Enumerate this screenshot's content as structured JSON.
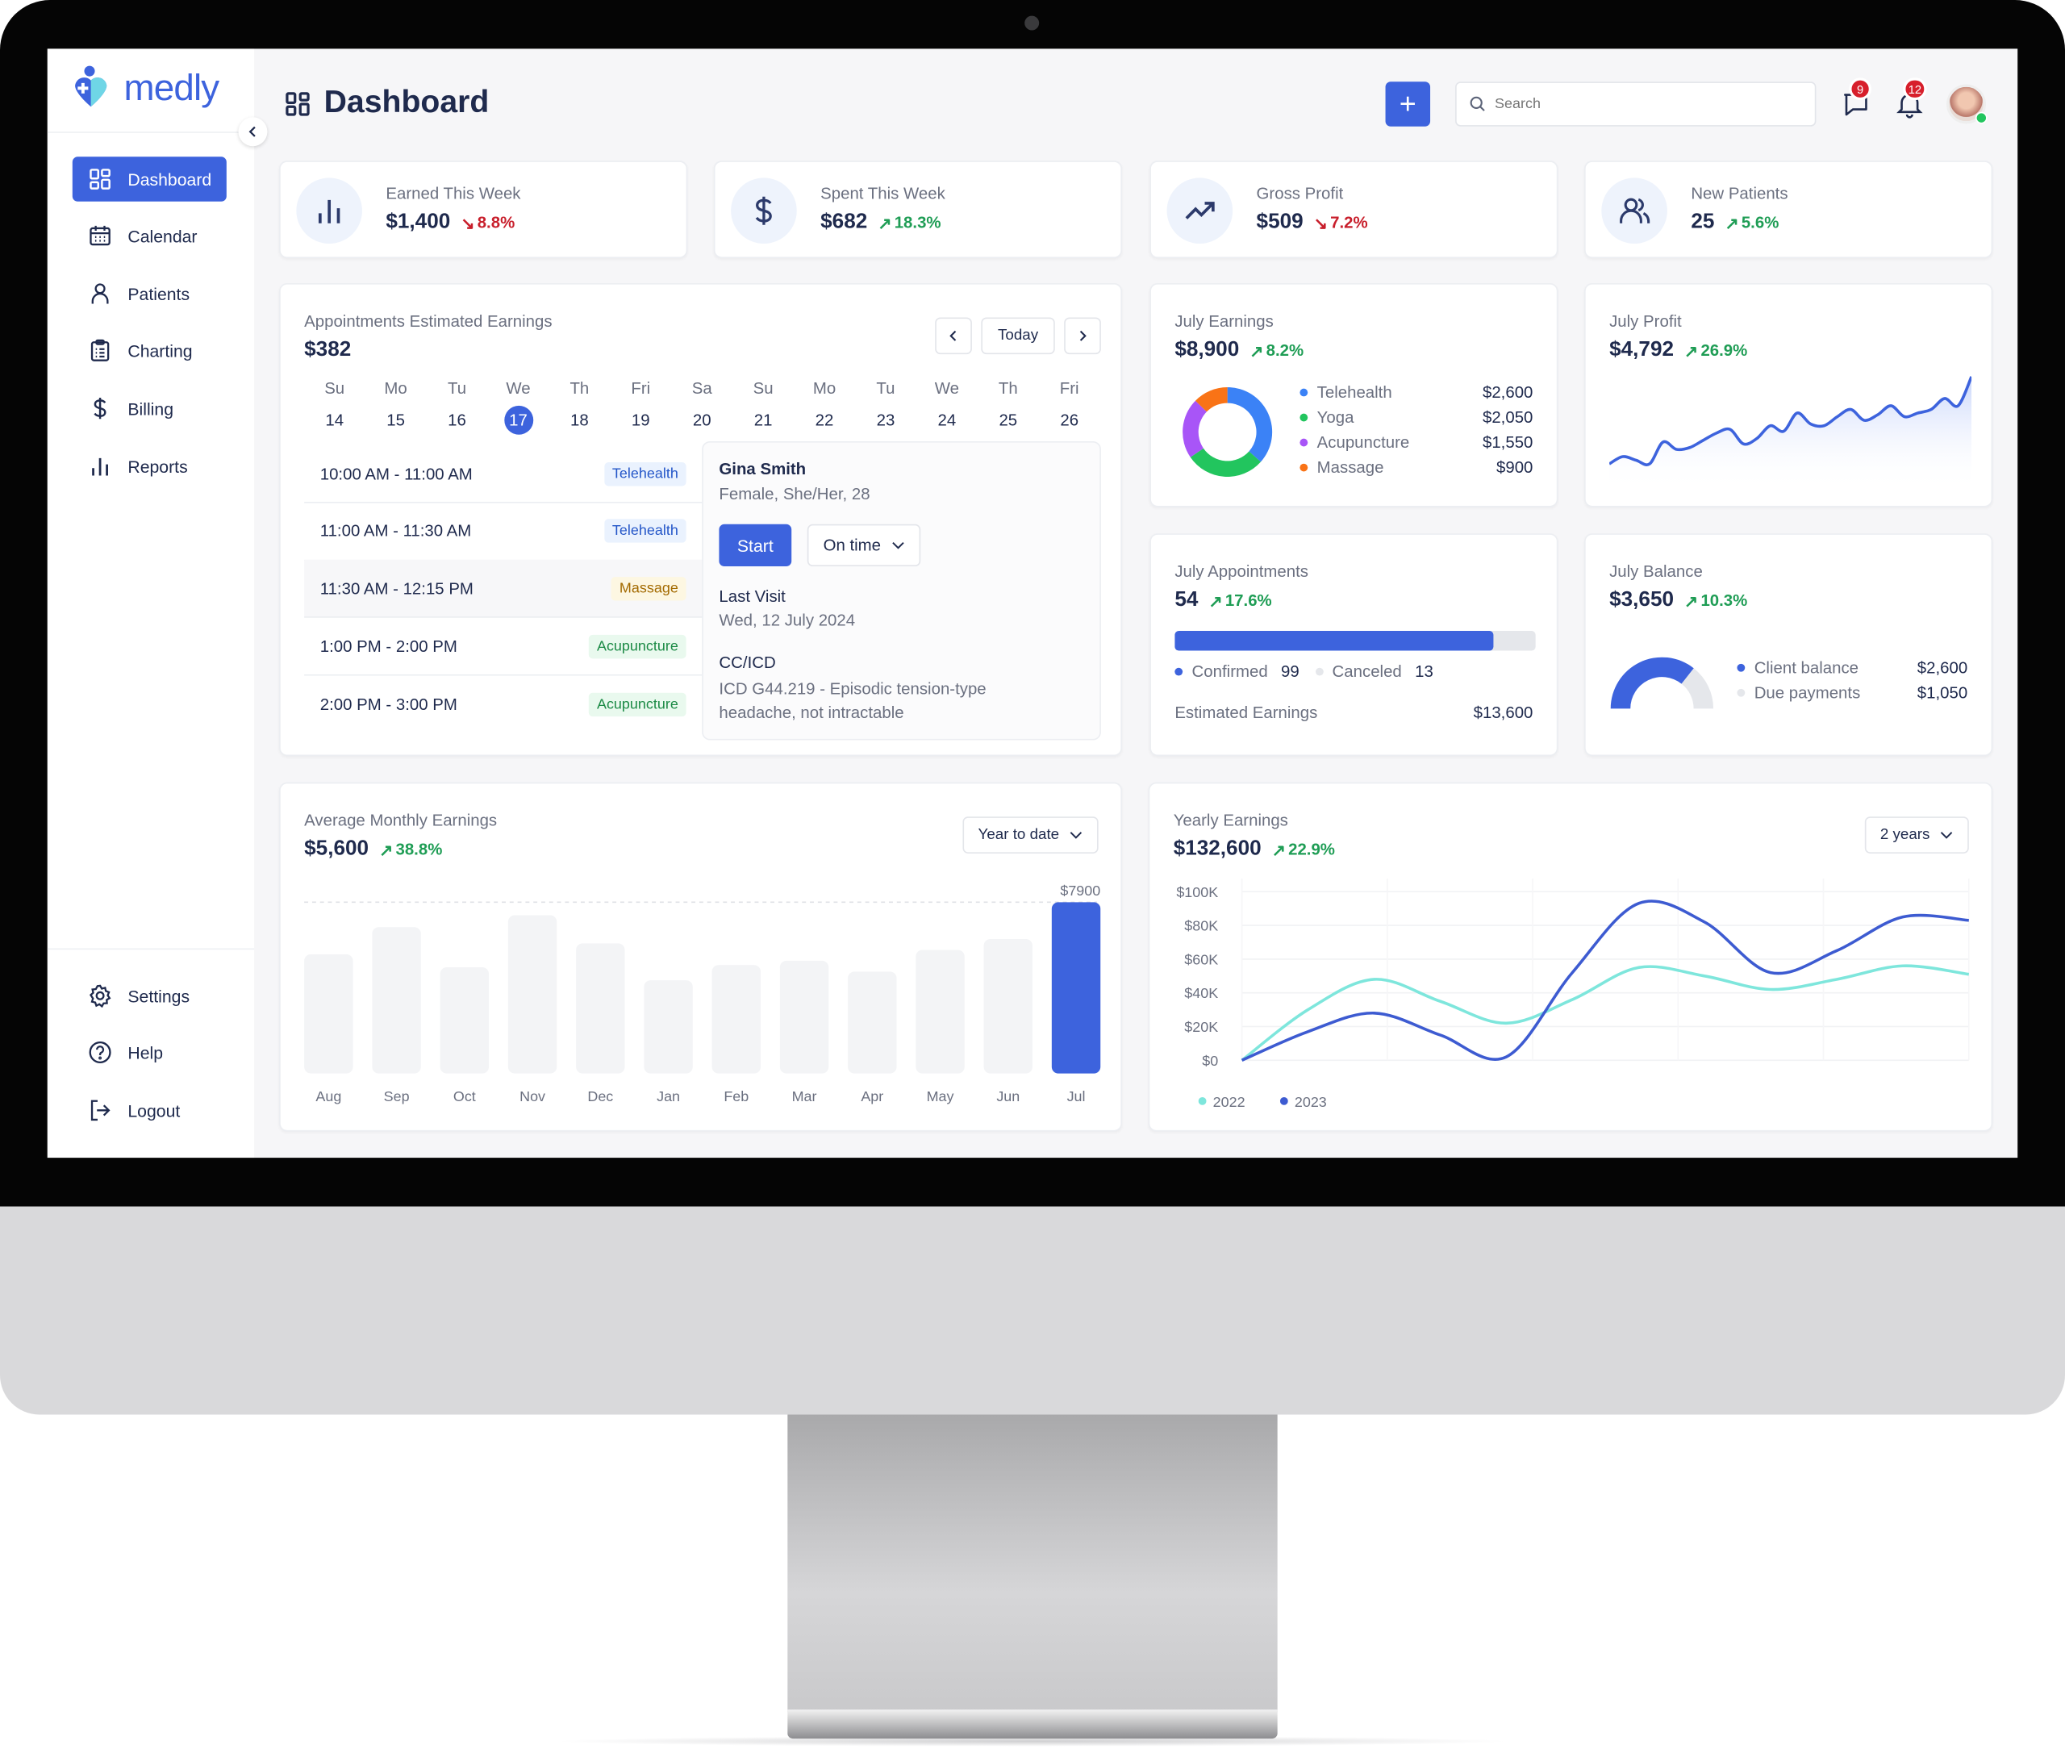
{
  "brand": {
    "name": "medly",
    "accent": "#3d63dd"
  },
  "header": {
    "title": "Dashboard",
    "search_placeholder": "Search",
    "messages_count": "9",
    "notifications_count": "12"
  },
  "sidebar": {
    "items": [
      {
        "label": "Dashboard",
        "icon": "dashboard-icon",
        "active": true
      },
      {
        "label": "Calendar",
        "icon": "calendar-icon"
      },
      {
        "label": "Patients",
        "icon": "user-icon"
      },
      {
        "label": "Charting",
        "icon": "clipboard-icon"
      },
      {
        "label": "Billing",
        "icon": "dollar-icon"
      },
      {
        "label": "Reports",
        "icon": "bar-chart-icon"
      }
    ],
    "bottom": [
      {
        "label": "Settings",
        "icon": "gear-icon"
      },
      {
        "label": "Help",
        "icon": "help-icon"
      },
      {
        "label": "Logout",
        "icon": "logout-icon"
      }
    ]
  },
  "stats": [
    {
      "label": "Earned This Week",
      "value": "$1,400",
      "change": "8.8%",
      "trend": "down",
      "icon": "bar-chart-icon"
    },
    {
      "label": "Spent This Week",
      "value": "$682",
      "change": "18.3%",
      "trend": "up",
      "icon": "dollar-icon"
    },
    {
      "label": "Gross Profit",
      "value": "$509",
      "change": "7.2%",
      "trend": "down",
      "icon": "trending-up-icon"
    },
    {
      "label": "New Patients",
      "value": "25",
      "change": "5.6%",
      "trend": "up",
      "icon": "users-icon"
    }
  ],
  "appointments": {
    "title": "Appointments Estimated Earnings",
    "value": "$382",
    "today_label": "Today",
    "days": [
      {
        "d": "Su",
        "n": "14"
      },
      {
        "d": "Mo",
        "n": "15"
      },
      {
        "d": "Tu",
        "n": "16"
      },
      {
        "d": "We",
        "n": "17",
        "selected": true
      },
      {
        "d": "Th",
        "n": "18"
      },
      {
        "d": "Fri",
        "n": "19"
      },
      {
        "d": "Sa",
        "n": "20"
      },
      {
        "d": "Su",
        "n": "21"
      },
      {
        "d": "Mo",
        "n": "22"
      },
      {
        "d": "Tu",
        "n": "23"
      },
      {
        "d": "We",
        "n": "24"
      },
      {
        "d": "Th",
        "n": "25"
      },
      {
        "d": "Fri",
        "n": "26"
      }
    ],
    "list": [
      {
        "time": "10:00 AM - 11:00 AM",
        "type": "Telehealth"
      },
      {
        "time": "11:00 AM - 11:30 AM",
        "type": "Telehealth"
      },
      {
        "time": "11:30 AM - 12:15 PM",
        "type": "Massage",
        "selected": true
      },
      {
        "time": "1:00 PM - 2:00 PM",
        "type": "Acupuncture"
      },
      {
        "time": "2:00 PM - 3:00 PM",
        "type": "Acupuncture"
      }
    ],
    "patient": {
      "name": "Gina Smith",
      "details": "Female, She/Her, 28",
      "start_label": "Start",
      "status": "On time",
      "last_visit_label": "Last Visit",
      "last_visit": "Wed, 12 July 2024",
      "cc_label": "CC/ICD",
      "cc": "ICD G44.219 - Episodic tension-type headache, not intractable"
    }
  },
  "july_earnings": {
    "title": "July Earnings",
    "value": "$8,900",
    "change": "8.2%",
    "chart_data": {
      "type": "pie",
      "donut": true,
      "slices": [
        {
          "name": "Telehealth",
          "value": 2600,
          "label": "$2,600",
          "color": "#3b82f6"
        },
        {
          "name": "Yoga",
          "value": 2050,
          "label": "$2,050",
          "color": "#22c55e"
        },
        {
          "name": "Acupuncture",
          "value": 1550,
          "label": "$1,550",
          "color": "#a855f7"
        },
        {
          "name": "Massage",
          "value": 900,
          "label": "$900",
          "color": "#f97316"
        }
      ]
    }
  },
  "july_profit": {
    "title": "July Profit",
    "value": "$4,792",
    "change": "26.9%",
    "chart_data": {
      "type": "area",
      "values": [
        10,
        14,
        12,
        10,
        22,
        18,
        19,
        23,
        27,
        29,
        21,
        24,
        31,
        28,
        38,
        32,
        31,
        36,
        40,
        34,
        37,
        42,
        36,
        38,
        40,
        46,
        42,
        58
      ]
    }
  },
  "july_appointments": {
    "title": "July Appointments",
    "value": "54",
    "change": "17.6%",
    "confirmed_label": "Confirmed",
    "confirmed": 99,
    "canceled_label": "Canceled",
    "canceled": 13,
    "est_label": "Estimated Earnings",
    "est_value": "$13,600"
  },
  "july_balance": {
    "title": "July Balance",
    "value": "$3,650",
    "change": "10.3%",
    "chart_data": {
      "type": "pie",
      "half_donut": true,
      "slices": [
        {
          "name": "Client balance",
          "value": 2600,
          "label": "$2,600",
          "color": "#3d63dd"
        },
        {
          "name": "Due payments",
          "value": 1050,
          "label": "$1,050",
          "color": "#e5e7eb"
        }
      ]
    }
  },
  "avg_monthly": {
    "title": "Average Monthly Earnings",
    "value": "$5,600",
    "change": "38.8%",
    "filter": "Year to date",
    "chart_data": {
      "type": "bar",
      "categories": [
        "Aug",
        "Sep",
        "Oct",
        "Nov",
        "Dec",
        "Jan",
        "Feb",
        "Mar",
        "Apr",
        "May",
        "Jun",
        "Jul"
      ],
      "values": [
        5500,
        6750,
        4900,
        7300,
        6000,
        4300,
        5000,
        5200,
        4700,
        5700,
        6200,
        7900
      ],
      "highlight": "Jul",
      "highlight_label": "$7900",
      "highlight_color": "#3d63dd"
    }
  },
  "yearly": {
    "title": "Yearly Earnings",
    "value": "$132,600",
    "change": "22.9%",
    "filter": "2 years",
    "chart_data": {
      "type": "line",
      "ylim": [
        0,
        100000
      ],
      "yticks": [
        "$0",
        "$20K",
        "$40K",
        "$60K",
        "$80K",
        "$100K"
      ],
      "grid": true,
      "legend": "bottom-left",
      "series": [
        {
          "name": "2022",
          "color": "#7ee6dc",
          "values": [
            0,
            30000,
            48000,
            35000,
            22000,
            36000,
            55000,
            50000,
            42000,
            48000,
            56000,
            51000
          ]
        },
        {
          "name": "2023",
          "color": "#3d5bd1",
          "values": [
            0,
            17000,
            28000,
            15000,
            2000,
            52000,
            93000,
            82000,
            52000,
            65000,
            85000,
            83000
          ]
        }
      ]
    }
  }
}
